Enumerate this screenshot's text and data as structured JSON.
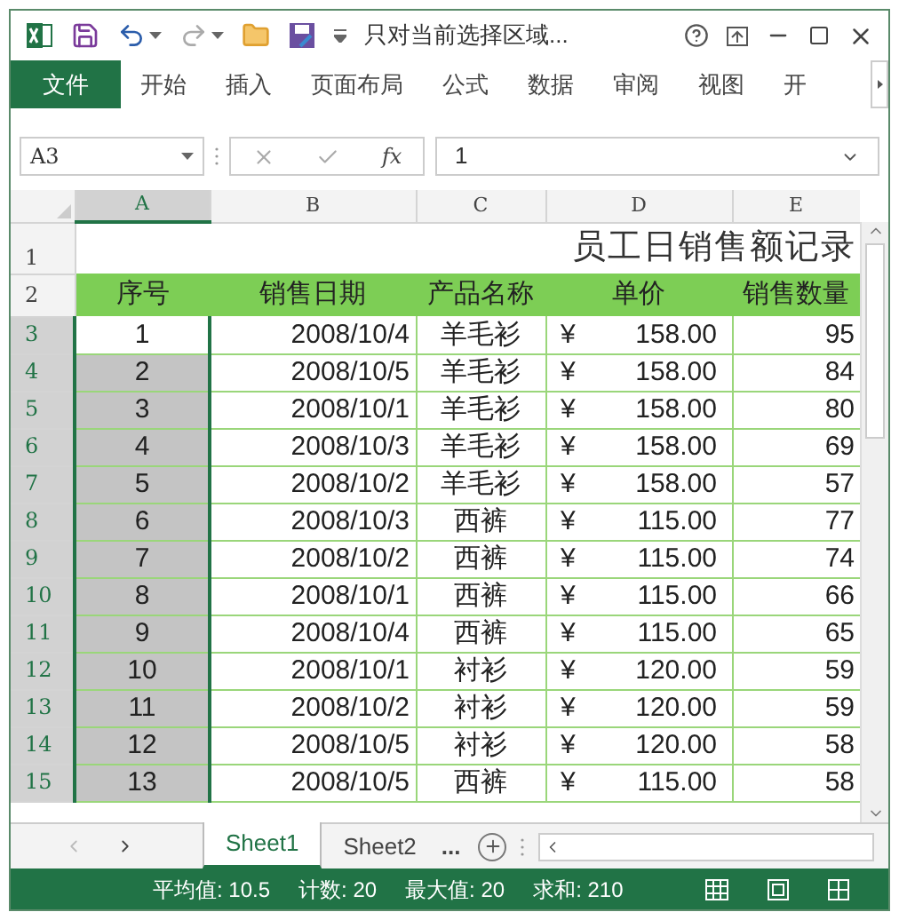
{
  "window": {
    "title": "只对当前选择区域..."
  },
  "ribbon_tabs": [
    {
      "label": "文件",
      "kind": "file"
    },
    {
      "label": "开始",
      "kind": "tab"
    },
    {
      "label": "插入",
      "kind": "tab"
    },
    {
      "label": "页面布局",
      "kind": "tab"
    },
    {
      "label": "公式",
      "kind": "tab"
    },
    {
      "label": "数据",
      "kind": "tab"
    },
    {
      "label": "审阅",
      "kind": "tab"
    },
    {
      "label": "视图",
      "kind": "tab"
    },
    {
      "label": "开",
      "kind": "tab"
    }
  ],
  "formula_bar": {
    "name_box": "A3",
    "function_label": "fx",
    "value": "1"
  },
  "sheet": {
    "columns": [
      {
        "label": "A",
        "selected": true
      },
      {
        "label": "B",
        "selected": false
      },
      {
        "label": "C",
        "selected": false
      },
      {
        "label": "D",
        "selected": false
      },
      {
        "label": "E",
        "selected": false
      }
    ],
    "title_row": "1",
    "title": "员工日销售额记录",
    "header_row": "2",
    "headers": [
      "序号",
      "销售日期",
      "产品名称",
      "单价",
      "销售数量"
    ],
    "rows": [
      {
        "row": "3",
        "seq": "1",
        "date": "2008/10/4",
        "product": "羊毛衫",
        "currency": "¥",
        "price": "158.00",
        "quantity": "95",
        "selected": true,
        "active": true
      },
      {
        "row": "4",
        "seq": "2",
        "date": "2008/10/5",
        "product": "羊毛衫",
        "currency": "¥",
        "price": "158.00",
        "quantity": "84",
        "selected": true,
        "active": false
      },
      {
        "row": "5",
        "seq": "3",
        "date": "2008/10/1",
        "product": "羊毛衫",
        "currency": "¥",
        "price": "158.00",
        "quantity": "80",
        "selected": true,
        "active": false
      },
      {
        "row": "6",
        "seq": "4",
        "date": "2008/10/3",
        "product": "羊毛衫",
        "currency": "¥",
        "price": "158.00",
        "quantity": "69",
        "selected": true,
        "active": false
      },
      {
        "row": "7",
        "seq": "5",
        "date": "2008/10/2",
        "product": "羊毛衫",
        "currency": "¥",
        "price": "158.00",
        "quantity": "57",
        "selected": true,
        "active": false
      },
      {
        "row": "8",
        "seq": "6",
        "date": "2008/10/3",
        "product": "西裤",
        "currency": "¥",
        "price": "115.00",
        "quantity": "77",
        "selected": true,
        "active": false
      },
      {
        "row": "9",
        "seq": "7",
        "date": "2008/10/2",
        "product": "西裤",
        "currency": "¥",
        "price": "115.00",
        "quantity": "74",
        "selected": true,
        "active": false
      },
      {
        "row": "10",
        "seq": "8",
        "date": "2008/10/1",
        "product": "西裤",
        "currency": "¥",
        "price": "115.00",
        "quantity": "66",
        "selected": true,
        "active": false
      },
      {
        "row": "11",
        "seq": "9",
        "date": "2008/10/4",
        "product": "西裤",
        "currency": "¥",
        "price": "115.00",
        "quantity": "65",
        "selected": true,
        "active": false
      },
      {
        "row": "12",
        "seq": "10",
        "date": "2008/10/1",
        "product": "衬衫",
        "currency": "¥",
        "price": "120.00",
        "quantity": "59",
        "selected": true,
        "active": false
      },
      {
        "row": "13",
        "seq": "11",
        "date": "2008/10/2",
        "product": "衬衫",
        "currency": "¥",
        "price": "120.00",
        "quantity": "59",
        "selected": true,
        "active": false
      },
      {
        "row": "14",
        "seq": "12",
        "date": "2008/10/5",
        "product": "衬衫",
        "currency": "¥",
        "price": "120.00",
        "quantity": "58",
        "selected": true,
        "active": false
      },
      {
        "row": "15",
        "seq": "13",
        "date": "2008/10/5",
        "product": "西裤",
        "currency": "¥",
        "price": "115.00",
        "quantity": "58",
        "selected": true,
        "active": false
      }
    ]
  },
  "sheet_tabs": [
    {
      "label": "Sheet1",
      "selected": true
    },
    {
      "label": "Sheet2",
      "selected": false
    }
  ],
  "sheet_tabs_more": "...",
  "status_bar": {
    "stats": [
      "平均值: 10.5",
      "计数: 20",
      "最大值: 20",
      "求和: 210"
    ]
  }
}
